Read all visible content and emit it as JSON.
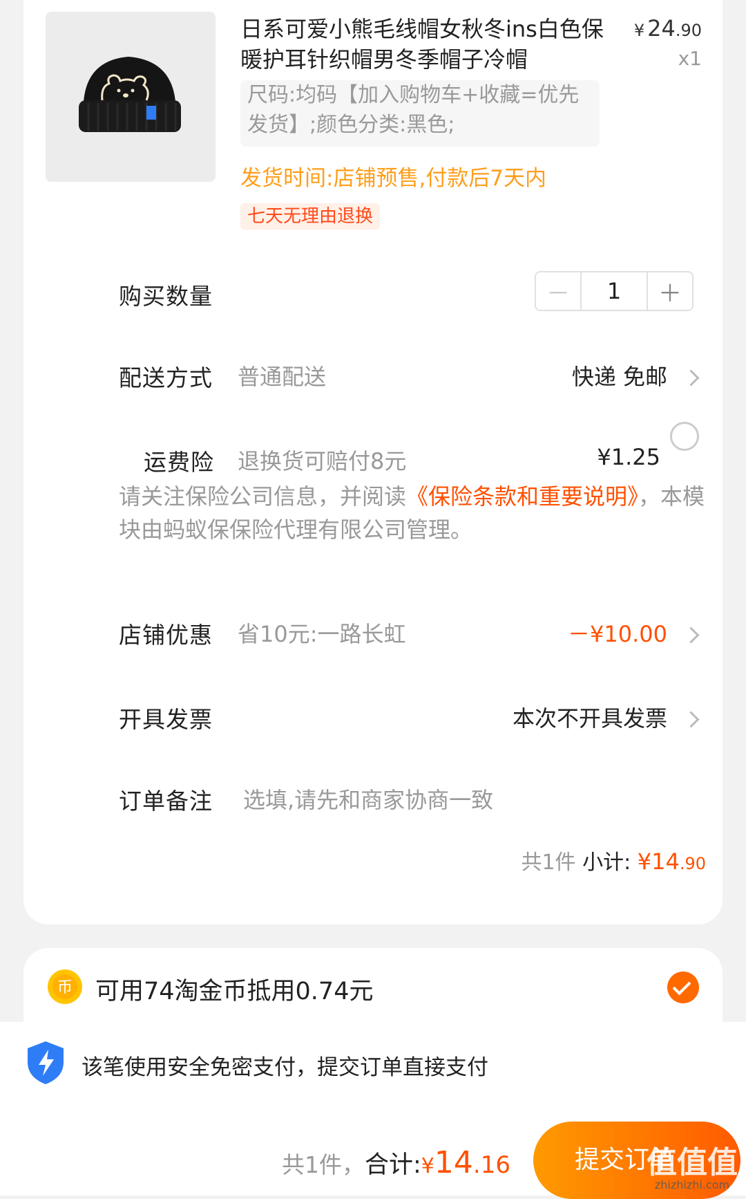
{
  "product": {
    "title": "日系可爱小熊毛线帽女秋冬ins白色保暖护耳针织帽男冬季帽子冷帽",
    "price_symbol": "¥",
    "price_int": "24",
    "price_dec": ".90",
    "quantity_text": "x1",
    "sku": "尺码:均码【加入购物车+收藏=优先发货】;颜色分类:黑色;",
    "ship_time": "发货时间:店铺预售,付款后7天内",
    "return_tag": "七天无理由退换"
  },
  "quantity": {
    "label": "购买数量",
    "minus": "－",
    "value": "1",
    "plus": "＋"
  },
  "delivery": {
    "label": "配送方式",
    "sub": "普通配送",
    "value": "快递 免邮"
  },
  "insurance": {
    "label": "运费险",
    "sub": "退换货可赔付8元",
    "price": "¥1.25",
    "notice_pre": "请关注保险公司信息，并阅读",
    "notice_link": "《保险条款和重要说明》",
    "notice_post": "，本模块由蚂蚁保保险代理有限公司管理。"
  },
  "store_discount": {
    "label": "店铺优惠",
    "sub": "省10元:一路长虹",
    "value": "－¥10.00"
  },
  "invoice": {
    "label": "开具发票",
    "value": "本次不开具发票"
  },
  "remark": {
    "label": "订单备注",
    "placeholder": "选填,请先和商家协商一致"
  },
  "subtotal": {
    "count": "共1件",
    "label": "小计:",
    "symbol": "¥",
    "int": "14",
    "dec": ".90"
  },
  "coins": {
    "text": "可用74淘金币抵用0.74元",
    "checked": true
  },
  "secure_pay": {
    "text": "该笔使用安全免密支付，提交订单直接支付"
  },
  "total": {
    "count": "共1件，",
    "label": "合计:",
    "symbol": "¥",
    "int": "14",
    "dec": ".16"
  },
  "submit": {
    "label": "提交订单"
  },
  "watermark": {
    "main": "值值值",
    "url": "zhizhizhi.com"
  },
  "colors": {
    "accent": "#ff5000",
    "warning": "#ff9e1b",
    "coin": "#ffc400",
    "shield": "#2f7df6"
  }
}
